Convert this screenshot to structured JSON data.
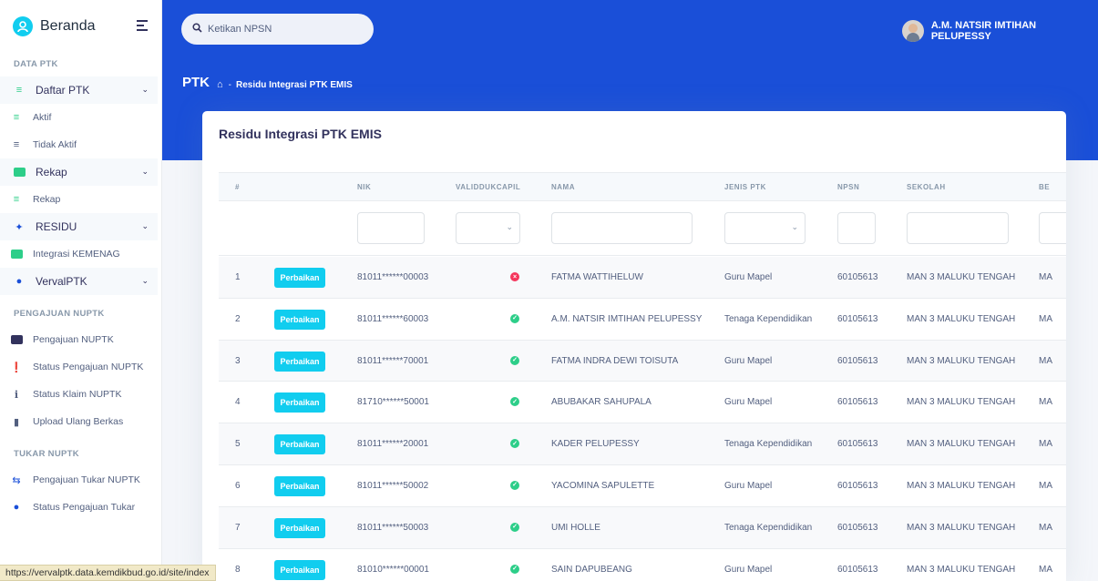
{
  "sidebar": {
    "brand": "Beranda",
    "sections": {
      "data_ptk": "DATA PTK",
      "pengajuan_nuptk": "PENGAJUAN NUPTK",
      "tukar_nuptk": "TUKAR NUPTK"
    },
    "groups": {
      "daftar_ptk": "Daftar PTK",
      "rekap": "Rekap",
      "residu": "RESIDU",
      "verval": "VervalPTK"
    },
    "items": {
      "aktif": "Aktif",
      "tidak_aktif": "Tidak Aktif",
      "rekap": "Rekap",
      "integrasi": "Integrasi KEMENAG",
      "pengajuan_nuptk": "Pengajuan NUPTK",
      "status_pengajuan_nuptk": "Status Pengajuan NUPTK",
      "status_klaim": "Status Klaim NUPTK",
      "upload_ulang": "Upload Ulang Berkas",
      "pengajuan_tukar": "Pengajuan Tukar NUPTK",
      "status_tukar": "Status Pengajuan Tukar"
    }
  },
  "header": {
    "search_placeholder": "Ketikan NPSN",
    "user_name": "A.M. NATSIR IMTIHAN PELUPESSY",
    "page_title": "PTK",
    "breadcrumb_sep": "-",
    "breadcrumb_current": "Residu Integrasi PTK EMIS"
  },
  "card": {
    "title": "Residu Integrasi PTK EMIS",
    "columns": [
      "#",
      "NIK",
      "VALIDDUKCAPIL",
      "NAMA",
      "JENIS PTK",
      "NPSN",
      "SEKOLAH",
      "BE"
    ],
    "action_label": "Perbaikan",
    "rows": [
      {
        "no": "1",
        "nik": "81011******00003",
        "valid": false,
        "nama": "FATMA WATTIHELUW",
        "jenis": "Guru Mapel",
        "npsn": "60105613",
        "sekolah": "MAN 3 MALUKU TENGAH",
        "be": "MA"
      },
      {
        "no": "2",
        "nik": "81011******60003",
        "valid": true,
        "nama": "A.M. NATSIR IMTIHAN PELUPESSY",
        "jenis": "Tenaga Kependidikan",
        "npsn": "60105613",
        "sekolah": "MAN 3 MALUKU TENGAH",
        "be": "MA"
      },
      {
        "no": "3",
        "nik": "81011******70001",
        "valid": true,
        "nama": "FATMA INDRA DEWI TOISUTA",
        "jenis": "Guru Mapel",
        "npsn": "60105613",
        "sekolah": "MAN 3 MALUKU TENGAH",
        "be": "MA"
      },
      {
        "no": "4",
        "nik": "81710******50001",
        "valid": true,
        "nama": "ABUBAKAR SAHUPALA",
        "jenis": "Guru Mapel",
        "npsn": "60105613",
        "sekolah": "MAN 3 MALUKU TENGAH",
        "be": "MA"
      },
      {
        "no": "5",
        "nik": "81011******20001",
        "valid": true,
        "nama": "KADER PELUPESSY",
        "jenis": "Tenaga Kependidikan",
        "npsn": "60105613",
        "sekolah": "MAN 3 MALUKU TENGAH",
        "be": "MA"
      },
      {
        "no": "6",
        "nik": "81011******50002",
        "valid": true,
        "nama": "YACOMINA SAPULETTE",
        "jenis": "Guru Mapel",
        "npsn": "60105613",
        "sekolah": "MAN 3 MALUKU TENGAH",
        "be": "MA"
      },
      {
        "no": "7",
        "nik": "81011******50003",
        "valid": true,
        "nama": "UMI HOLLE",
        "jenis": "Tenaga Kependidikan",
        "npsn": "60105613",
        "sekolah": "MAN 3 MALUKU TENGAH",
        "be": "MA"
      },
      {
        "no": "8",
        "nik": "81010******00001",
        "valid": true,
        "nama": "SAIN DAPUBEANG",
        "jenis": "Guru Mapel",
        "npsn": "60105613",
        "sekolah": "MAN 3 MALUKU TENGAH",
        "be": "MA"
      }
    ]
  },
  "status_url": "https://vervalptk.data.kemdikbud.go.id/site/index",
  "colors": {
    "header": "#1a4fd8",
    "accent": "#11cdef",
    "success": "#2dce89",
    "danger": "#f5365c"
  }
}
